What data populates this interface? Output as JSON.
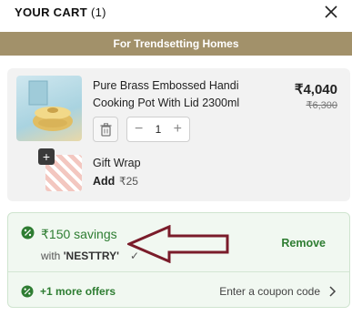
{
  "header": {
    "title": "YOUR CART",
    "count": "(1)"
  },
  "banner": {
    "text": "For Trendsetting Homes"
  },
  "product": {
    "name": "Pure Brass Embossed Handi Cooking Pot With Lid 2300ml",
    "price": "₹4,040",
    "mrp": "₹6,300",
    "quantity": "1",
    "decrement": "−",
    "increment": "+"
  },
  "gift": {
    "plus": "+",
    "title": "Gift Wrap",
    "add_label": "Add",
    "price": "₹25"
  },
  "coupon": {
    "savings": "₹150 savings",
    "with_prefix": "with",
    "code": "'NESTTRY'",
    "check": "✓",
    "remove_label": "Remove",
    "more_offers": "+1 more offers",
    "enter_coupon": "Enter a coupon code"
  },
  "colors": {
    "banner": "#a2916a",
    "accent_green": "#2e7d32",
    "annotation_arrow": "#7a1c2a"
  },
  "icons": [
    "close-icon",
    "trash-icon",
    "discount-icon",
    "chevron-right-icon",
    "annotation-arrow"
  ]
}
